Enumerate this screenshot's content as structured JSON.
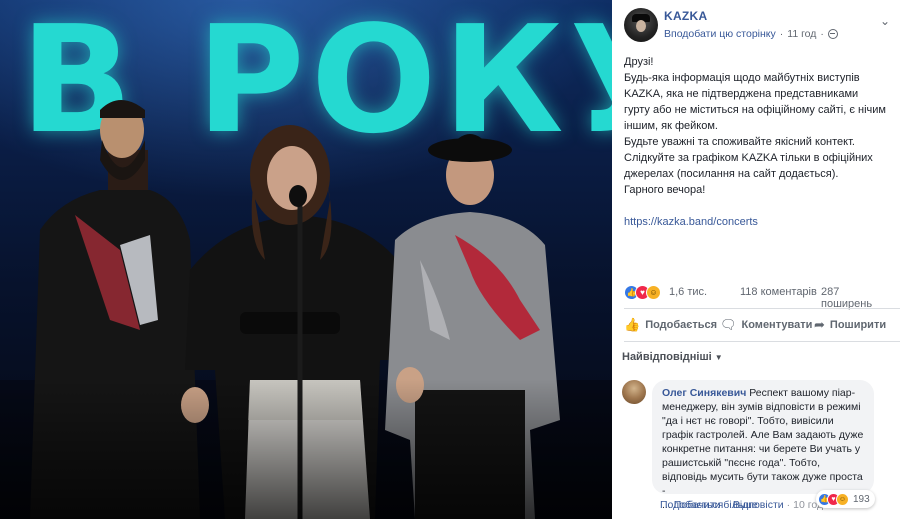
{
  "photo": {
    "stage_text": "В РОКУ"
  },
  "post": {
    "page_name": "KAZKA",
    "follow_label": "Вподобати цю сторінку",
    "separator": "·",
    "time": "11 год",
    "privacy_icon": "globe-icon",
    "menu_icon": "chevron-down-icon",
    "body_text": "Друзі!\nБудь-яка інформація щодо майбутніх виступів KAZKA, яка не підтверджена представниками гурту або не міститься на офіційному сайті, є нічим іншим, як фейком.\nБудьте уважні та споживайте якісний контект.\nСлідкуйте за графіком KAZKA тільки в офіційних джерелах (посилання на сайт додається).\nГарного вечора!",
    "link": "https://kazka.band/concerts"
  },
  "stats": {
    "reactions": "1,6 тис.",
    "comments": "118 коментарів",
    "shares": "287 поширень"
  },
  "actions": {
    "like": "Подобається",
    "comment": "Коментувати",
    "share": "Поширити"
  },
  "sort": {
    "label": "Найвідповідніші"
  },
  "comment": {
    "author": "Олег Синякевич",
    "text": "Респект вашому піар-менеджеру, він зумів відповісти в режимі \"да і нєт нє говорі\". Тобто, вивісили графік гастролей. Але Вам задають дуже конкретне питання: чи берете Ви учать у рашистській \"пєснє года\". Тобто, відповідь мусить бути також дуже проста -",
    "ellipsis": "...",
    "see_more": "Побачити більше",
    "like": "Подобається",
    "reply": "Відповісти",
    "time": "10 год",
    "reaction_count": "193"
  },
  "colors": {
    "link": "#385898",
    "muted": "#616770",
    "bubble": "#f2f3f5",
    "like": "#3578e5",
    "love": "#f0284a",
    "haha": "#f7b125",
    "stage_text": "#25d9d1"
  }
}
